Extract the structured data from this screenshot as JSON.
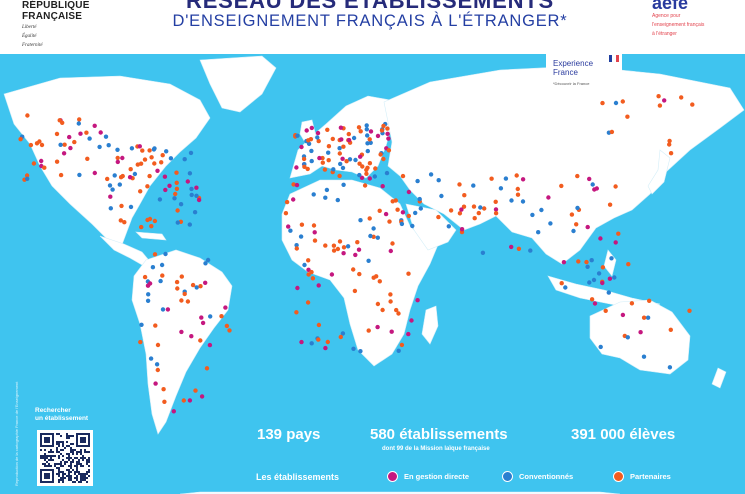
{
  "header": {
    "gov_logo": {
      "lines": [
        "RÉPUBLIQUE",
        "FRANÇAISE"
      ],
      "motto": [
        "Liberté",
        "Égalité",
        "Fraternité"
      ]
    },
    "title": "RÉSEAU DES ÉTABLISSEMENTS",
    "subtitle": "D'ENSEIGNEMENT FRANÇAIS À L'ÉTRANGER*",
    "aefe_logo": {
      "word": "aefe",
      "tagline": [
        "Agence pour",
        "l'enseignement français",
        "à l'étranger"
      ]
    }
  },
  "experience_france": {
    "name_line1": "Experience",
    "name_line2": "France",
    "tagline": "*Découvrir la France",
    "flag_colors": [
      "#1f3fa0",
      "#ffffff",
      "#e2434d"
    ]
  },
  "search": {
    "label_line1": "Rechercher",
    "label_line2": "un établissement"
  },
  "credit": "Reproduction de la cartographie France de l'Enseignement",
  "stats": {
    "countries": "139 pays",
    "schools": "580 établissements",
    "schools_note": "dont 99 de la Mission laïque française",
    "students": "391 000 élèves"
  },
  "legend": {
    "title": "Les établissements",
    "items": [
      {
        "label": "En gestion directe",
        "color": "#c5177f"
      },
      {
        "label": "Conventionnés",
        "color": "#2a7fd0"
      },
      {
        "label": "Partenaires",
        "color": "#f25c1f"
      }
    ]
  },
  "colors": {
    "ocean": "#3fc4ef",
    "land": "#ffffff",
    "title": "#262b7a",
    "subtitle": "#243fa3"
  }
}
